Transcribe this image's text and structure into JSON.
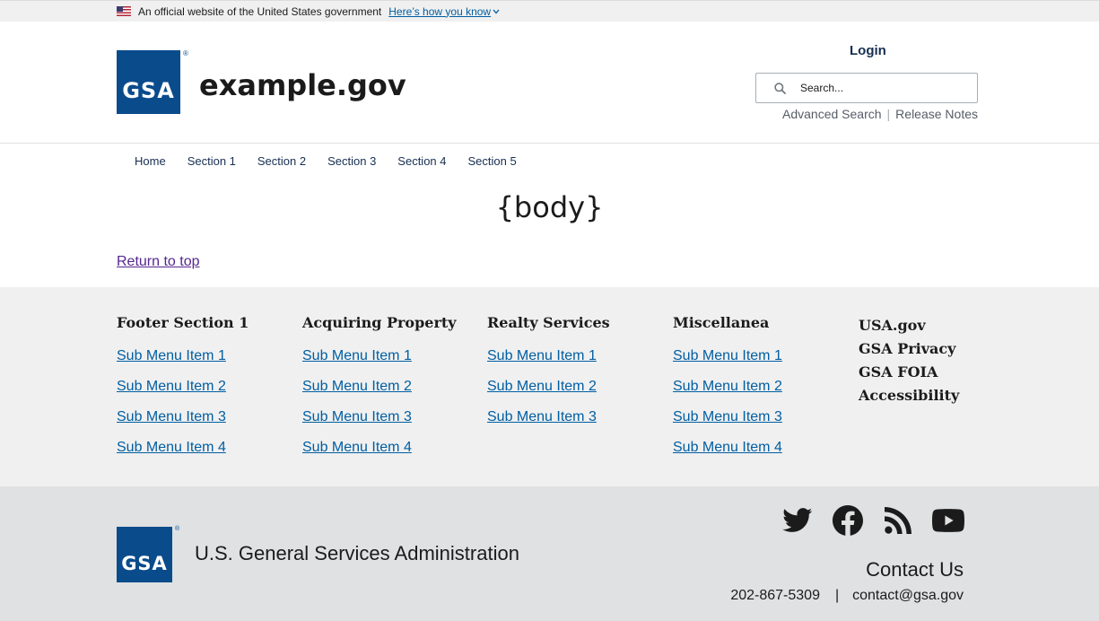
{
  "banner": {
    "text": "An official website of the United States government",
    "link": "Here’s how you know"
  },
  "header": {
    "logo_text": "GSA",
    "reg_mark": "®",
    "site_name": "example.gov",
    "login": "Login",
    "search_placeholder": "Search...",
    "advanced_search": "Advanced Search",
    "separator": "|",
    "release_notes": "Release Notes"
  },
  "nav": {
    "items": [
      "Home",
      "Section 1",
      "Section 2",
      "Section 3",
      "Section 4",
      "Section 5"
    ]
  },
  "body": {
    "placeholder": "{body}",
    "return_to_top": "Return to top"
  },
  "footer": {
    "columns": [
      {
        "heading": "Footer Section 1",
        "items": [
          "Sub Menu Item 1",
          "Sub Menu Item 2",
          "Sub Menu Item 3",
          "Sub Menu Item 4"
        ]
      },
      {
        "heading": "Acquiring Property",
        "items": [
          "Sub Menu Item 1",
          "Sub Menu Item 2",
          "Sub Menu Item 3",
          "Sub Menu Item 4"
        ]
      },
      {
        "heading": "Realty Services",
        "items": [
          "Sub Menu Item 1",
          "Sub Menu Item 2",
          "Sub Menu Item 3"
        ]
      },
      {
        "heading": "Miscellanea",
        "items": [
          "Sub Menu Item 1",
          "Sub Menu Item 2",
          "Sub Menu Item 3",
          "Sub Menu Item 4"
        ]
      }
    ],
    "links": [
      "USA.gov",
      "GSA Privacy",
      "GSA FOIA",
      "Accessibility"
    ]
  },
  "footer_secondary": {
    "logo_text": "GSA",
    "reg_mark": "®",
    "agency_name": "U.S. General Services Administration",
    "contact_heading": "Contact Us",
    "phone": "202-867-5309",
    "pipe": "|",
    "email": "contact@gsa.gov",
    "social_icons": [
      "twitter-icon",
      "facebook-icon",
      "rss-icon",
      "youtube-icon"
    ]
  },
  "colors": {
    "gsa_blue": "#0a4b8c",
    "link_blue": "#005ea2",
    "visited_purple": "#54278f",
    "nav_navy": "#162e51",
    "footer_primary_bg": "#f0f0f0",
    "footer_secondary_bg": "#dfe1e2"
  }
}
